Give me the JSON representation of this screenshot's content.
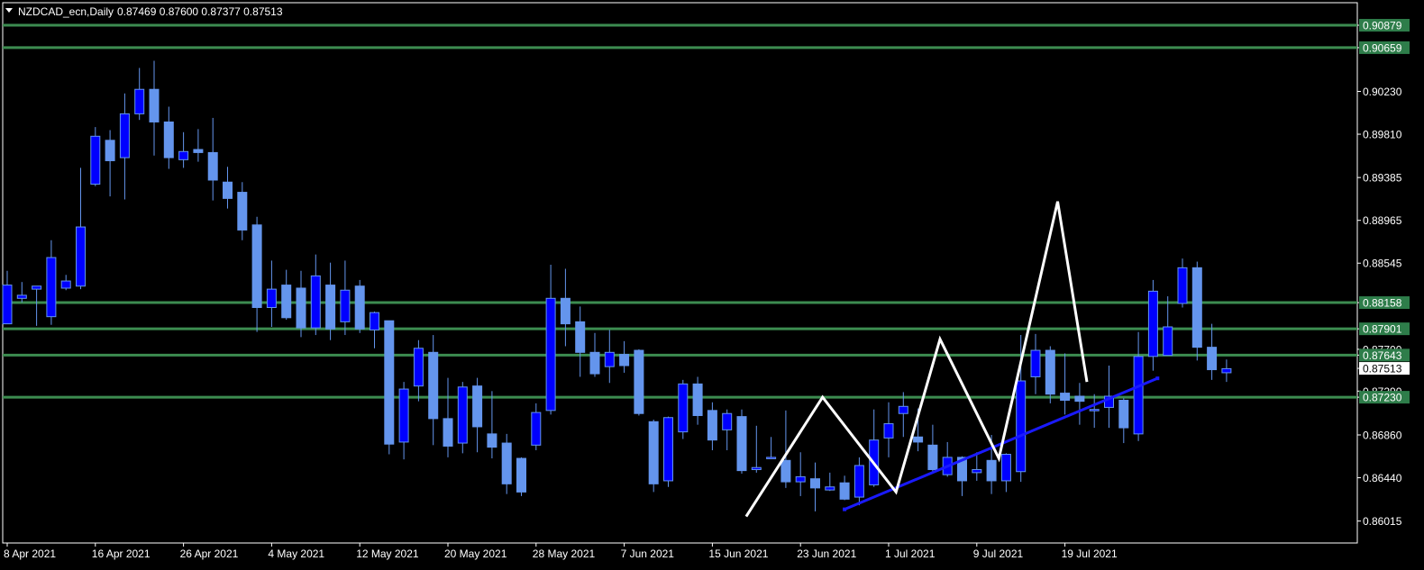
{
  "header": {
    "symbol_label": "NZDCAD_ecn,Daily",
    "ohlc_label": "0.87469 0.87600 0.87377 0.87513"
  },
  "colors": {
    "background": "#000000",
    "bull_candle": "#0000ff",
    "bear_candle": "#6495ed",
    "level_line": "#3c8c50",
    "level_label_bg": "#2e7d4a",
    "trendline": "#1a1aff",
    "pattern_line": "#ffffff",
    "axis": "#ffffff"
  },
  "chart_data": {
    "type": "candlestick",
    "ylim": [
      0.858,
      0.911
    ],
    "y_ticks": [
      "0.90879",
      "0.90659",
      "0.90230",
      "0.89810",
      "0.89385",
      "0.88965",
      "0.88545",
      "0.88158",
      "0.87901",
      "0.87700",
      "0.87643",
      "0.87513",
      "0.87290",
      "0.87230",
      "0.86860",
      "0.86440",
      "0.86015"
    ],
    "highlighted_ticks": [
      "0.90879",
      "0.90659",
      "0.88158",
      "0.87901",
      "0.87643",
      "0.87230"
    ],
    "current_price_tick": "0.87513",
    "x_ticks": [
      {
        "label": "8 Apr 2021",
        "index": 0
      },
      {
        "label": "16 Apr 2021",
        "index": 6
      },
      {
        "label": "26 Apr 2021",
        "index": 12
      },
      {
        "label": "4 May 2021",
        "index": 18
      },
      {
        "label": "12 May 2021",
        "index": 24
      },
      {
        "label": "20 May 2021",
        "index": 30
      },
      {
        "label": "28 May 2021",
        "index": 36
      },
      {
        "label": "7 Jun 2021",
        "index": 42
      },
      {
        "label": "15 Jun 2021",
        "index": 48
      },
      {
        "label": "23 Jun 2021",
        "index": 54
      },
      {
        "label": "1 Jul 2021",
        "index": 60
      },
      {
        "label": "9 Jul 2021",
        "index": 66
      },
      {
        "label": "19 Jul 2021",
        "index": 72
      }
    ],
    "candles": [
      [
        0.8795,
        0.8833,
        0.881,
        0.8847
      ],
      [
        0.882,
        0.8823,
        0.8816,
        0.8836
      ],
      [
        0.8829,
        0.8832,
        0.8793,
        0.8832
      ],
      [
        0.8802,
        0.886,
        0.8794,
        0.8877
      ],
      [
        0.883,
        0.8837,
        0.8828,
        0.8843
      ],
      [
        0.8832,
        0.889,
        0.8829,
        0.8948
      ],
      [
        0.8932,
        0.8979,
        0.893,
        0.8988
      ],
      [
        0.8975,
        0.8955,
        0.892,
        0.8985
      ],
      [
        0.8958,
        0.9001,
        0.8917,
        0.9021
      ],
      [
        0.9001,
        0.9025,
        0.8995,
        0.9046
      ],
      [
        0.9025,
        0.8993,
        0.896,
        0.9053
      ],
      [
        0.8993,
        0.8958,
        0.8947,
        0.9008
      ],
      [
        0.8956,
        0.8964,
        0.8948,
        0.8983
      ],
      [
        0.8966,
        0.8963,
        0.8954,
        0.8986
      ],
      [
        0.8963,
        0.8936,
        0.8916,
        0.8997
      ],
      [
        0.8934,
        0.8918,
        0.8908,
        0.8949
      ],
      [
        0.8924,
        0.8887,
        0.8877,
        0.8934
      ],
      [
        0.8892,
        0.8811,
        0.8787,
        0.89
      ],
      [
        0.8811,
        0.8829,
        0.8792,
        0.8857
      ],
      [
        0.8833,
        0.8801,
        0.8799,
        0.8848
      ],
      [
        0.883,
        0.8791,
        0.8782,
        0.8847
      ],
      [
        0.8791,
        0.8842,
        0.8784,
        0.8863
      ],
      [
        0.8833,
        0.879,
        0.8779,
        0.8855
      ],
      [
        0.8797,
        0.8828,
        0.8784,
        0.8857
      ],
      [
        0.8832,
        0.879,
        0.8786,
        0.8838
      ],
      [
        0.8789,
        0.8806,
        0.8771,
        0.8807
      ],
      [
        0.8798,
        0.8677,
        0.8667,
        0.8798
      ],
      [
        0.8679,
        0.8731,
        0.8662,
        0.8738
      ],
      [
        0.8734,
        0.8771,
        0.8719,
        0.8779
      ],
      [
        0.8767,
        0.8702,
        0.8676,
        0.8784
      ],
      [
        0.8702,
        0.8675,
        0.8664,
        0.8742
      ],
      [
        0.8678,
        0.8733,
        0.8668,
        0.8738
      ],
      [
        0.8734,
        0.8694,
        0.8669,
        0.8742
      ],
      [
        0.8687,
        0.8674,
        0.8663,
        0.8729
      ],
      [
        0.8678,
        0.8638,
        0.8628,
        0.8687
      ],
      [
        0.8663,
        0.863,
        0.8626,
        0.8664
      ],
      [
        0.8676,
        0.8708,
        0.8671,
        0.8717
      ],
      [
        0.871,
        0.882,
        0.8706,
        0.8853
      ],
      [
        0.882,
        0.8795,
        0.8773,
        0.8849
      ],
      [
        0.8797,
        0.8767,
        0.8743,
        0.8812
      ],
      [
        0.8767,
        0.8746,
        0.8743,
        0.8786
      ],
      [
        0.8753,
        0.8767,
        0.8737,
        0.8789
      ],
      [
        0.8765,
        0.8754,
        0.8747,
        0.8778
      ],
      [
        0.8769,
        0.8707,
        0.8705,
        0.877
      ],
      [
        0.8699,
        0.8638,
        0.863,
        0.8701
      ],
      [
        0.8641,
        0.8703,
        0.8635,
        0.8704
      ],
      [
        0.8689,
        0.8736,
        0.8682,
        0.874
      ],
      [
        0.8736,
        0.8705,
        0.8696,
        0.8743
      ],
      [
        0.871,
        0.8681,
        0.8671,
        0.8718
      ],
      [
        0.8691,
        0.8707,
        0.8671,
        0.8711
      ],
      [
        0.8704,
        0.8651,
        0.8648,
        0.8711
      ],
      [
        0.8652,
        0.8654,
        0.8649,
        0.8695
      ],
      [
        0.8664,
        0.8664,
        0.8663,
        0.8684
      ],
      [
        0.8661,
        0.864,
        0.8634,
        0.871
      ],
      [
        0.864,
        0.8645,
        0.8626,
        0.8669
      ],
      [
        0.8643,
        0.8634,
        0.8611,
        0.8659
      ],
      [
        0.8632,
        0.8635,
        0.8631,
        0.8649
      ],
      [
        0.8639,
        0.8623,
        0.8622,
        0.8646
      ],
      [
        0.8625,
        0.8656,
        0.8617,
        0.8664
      ],
      [
        0.8637,
        0.8681,
        0.8635,
        0.8711
      ],
      [
        0.8683,
        0.8697,
        0.8664,
        0.8718
      ],
      [
        0.8707,
        0.8714,
        0.8684,
        0.8728
      ],
      [
        0.8684,
        0.8679,
        0.867,
        0.8712
      ],
      [
        0.8676,
        0.8652,
        0.8648,
        0.8696
      ],
      [
        0.8647,
        0.8664,
        0.8645,
        0.8679
      ],
      [
        0.8664,
        0.8641,
        0.8626,
        0.8665
      ],
      [
        0.8649,
        0.8652,
        0.8641,
        0.8669
      ],
      [
        0.8661,
        0.8641,
        0.8628,
        0.8686
      ],
      [
        0.8641,
        0.8667,
        0.863,
        0.8668
      ],
      [
        0.865,
        0.8739,
        0.864,
        0.8784
      ],
      [
        0.8743,
        0.8769,
        0.8726,
        0.8785
      ],
      [
        0.8769,
        0.8726,
        0.8717,
        0.8773
      ],
      [
        0.8727,
        0.872,
        0.8706,
        0.8766
      ],
      [
        0.8724,
        0.8719,
        0.8696,
        0.8737
      ],
      [
        0.8711,
        0.8711,
        0.8693,
        0.8726
      ],
      [
        0.8713,
        0.8724,
        0.8693,
        0.8754
      ],
      [
        0.872,
        0.8693,
        0.8678,
        0.8722
      ],
      [
        0.8687,
        0.8763,
        0.868,
        0.8787
      ],
      [
        0.8763,
        0.8827,
        0.8749,
        0.8838
      ],
      [
        0.8764,
        0.8792,
        0.8764,
        0.8822
      ],
      [
        0.8815,
        0.885,
        0.8811,
        0.8859
      ],
      [
        0.885,
        0.8772,
        0.8759,
        0.8856
      ],
      [
        0.8772,
        0.875,
        0.874,
        0.8795
      ],
      [
        0.8747,
        0.8751,
        0.8738,
        0.876
      ]
    ],
    "levels": [
      0.90879,
      0.90659,
      0.88158,
      0.87901,
      0.87643,
      0.8723
    ],
    "trendline": [
      [
        57.0,
        0.8613
      ],
      [
        78.3,
        0.87415
      ]
    ],
    "zigzag_pattern": [
      [
        50.3,
        0.8606
      ],
      [
        55.5,
        0.8723
      ],
      [
        60.5,
        0.863
      ],
      [
        63.5,
        0.878
      ],
      [
        67.5,
        0.8663
      ],
      [
        71.5,
        0.8915
      ],
      [
        73.5,
        0.8738
      ]
    ]
  }
}
